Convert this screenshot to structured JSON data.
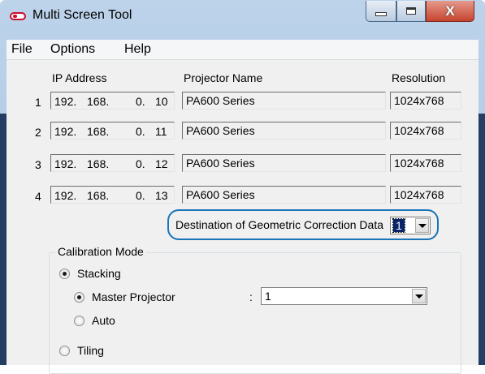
{
  "window": {
    "title": "Multi Screen Tool",
    "controls": {
      "minimize_glyph": "",
      "maximize_glyph": "",
      "close_glyph": "X"
    }
  },
  "menu": [
    "File",
    "Options",
    "Help"
  ],
  "columns": {
    "ip": "IP Address",
    "name": "Projector Name",
    "resolution": "Resolution"
  },
  "projectors": [
    {
      "num": "1",
      "ip": [
        "192.",
        "168.",
        "0.",
        "10"
      ],
      "name": "PA600 Series",
      "resolution": "1024x768"
    },
    {
      "num": "2",
      "ip": [
        "192.",
        "168.",
        "0.",
        "11"
      ],
      "name": "PA600 Series",
      "resolution": "1024x768"
    },
    {
      "num": "3",
      "ip": [
        "192.",
        "168.",
        "0.",
        "12"
      ],
      "name": "PA600 Series",
      "resolution": "1024x768"
    },
    {
      "num": "4",
      "ip": [
        "192.",
        "168.",
        "0.",
        "13"
      ],
      "name": "PA600 Series",
      "resolution": "1024x768"
    }
  ],
  "destination": {
    "label": "Destination of Geometric Correction Data",
    "value": "1"
  },
  "calibration": {
    "legend": "Calibration Mode",
    "stacking_label": "Stacking",
    "master_label": "Master Projector",
    "master_colon": ":",
    "master_value": "1",
    "auto_label": "Auto",
    "tiling_label": "Tiling"
  },
  "colors": {
    "highlight_border": "#1a74b8",
    "close_button": "#c6432e"
  }
}
